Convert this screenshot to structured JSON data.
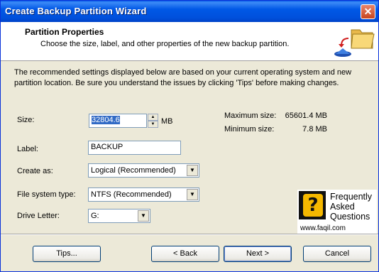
{
  "window": {
    "title": "Create Backup Partition Wizard",
    "close_label": "✕"
  },
  "header": {
    "title": "Partition Properties",
    "subtitle": "Choose the size, label, and other properties of the new backup partition.",
    "icon": "folder-backup-icon"
  },
  "intro": "The recommended settings displayed below are based on your current operating system and new partition location. Be sure you understand the issues by clicking 'Tips' before making changes.",
  "form": {
    "size_label": "Size:",
    "size_value": "32804.6",
    "size_unit": "MB",
    "label_label": "Label:",
    "label_value": "BACKUP",
    "create_as_label": "Create as:",
    "create_as_value": "Logical (Recommended)",
    "fs_label": "File system type:",
    "fs_value": "NTFS (Recommended)",
    "drive_label": "Drive Letter:",
    "drive_value": "G:"
  },
  "stats": {
    "max_label": "Maximum size:",
    "max_value": "65601.4 MB",
    "min_label": "Minimum size:",
    "min_value": "7.8 MB"
  },
  "buttons": {
    "tips": "Tips...",
    "back": "< Back",
    "next": "Next >",
    "cancel": "Cancel"
  },
  "faq": {
    "mark": "?",
    "line1": "Frequently",
    "line2": "Asked",
    "line3": "Questions",
    "url": "www.faqil.com"
  }
}
